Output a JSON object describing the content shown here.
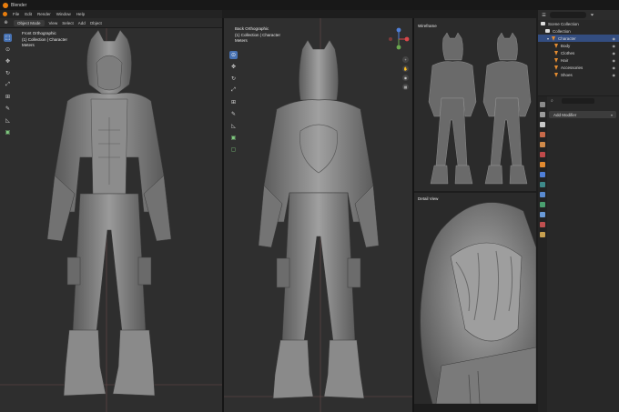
{
  "app": {
    "title": "Blender"
  },
  "menu": [
    "File",
    "Edit",
    "Render",
    "Window",
    "Help"
  ],
  "viewport_header": {
    "mode": "Object Mode",
    "menus": [
      "View",
      "Select",
      "Add",
      "Object"
    ]
  },
  "front_view": {
    "line1": "Front Orthographic",
    "line2": "(1) Collection | Character",
    "line3": "Meters"
  },
  "back_view": {
    "line1": "Back Orthographic",
    "line2": "(1) Collection | Character",
    "line3": "Meters"
  },
  "wireframe_view": {
    "label": "Wireframe"
  },
  "detail_view": {
    "label": "Detail View"
  },
  "outliner": {
    "items": [
      {
        "label": "Scene Collection",
        "level": 0
      },
      {
        "label": "Collection",
        "level": 1
      },
      {
        "label": "Character",
        "level": 2,
        "selected": true
      },
      {
        "label": "Body",
        "level": 3
      },
      {
        "label": "Clothes",
        "level": 3
      },
      {
        "label": "Hair",
        "level": 3
      },
      {
        "label": "Accessories",
        "level": 3
      },
      {
        "label": "Shoes",
        "level": 3
      }
    ]
  },
  "properties": {
    "add_modifier": "Add Modifier"
  },
  "colors": {
    "accent": "#4772b3",
    "blender_orange": "#e87d0d",
    "selection": "#334d80"
  },
  "icons": [
    "blender-logo-icon",
    "select-box-icon",
    "cursor-icon",
    "move-icon",
    "rotate-icon",
    "scale-icon",
    "transform-icon",
    "annotate-icon",
    "measure-icon",
    "add-cube-icon",
    "eye-icon",
    "search-icon",
    "wrench-icon"
  ]
}
